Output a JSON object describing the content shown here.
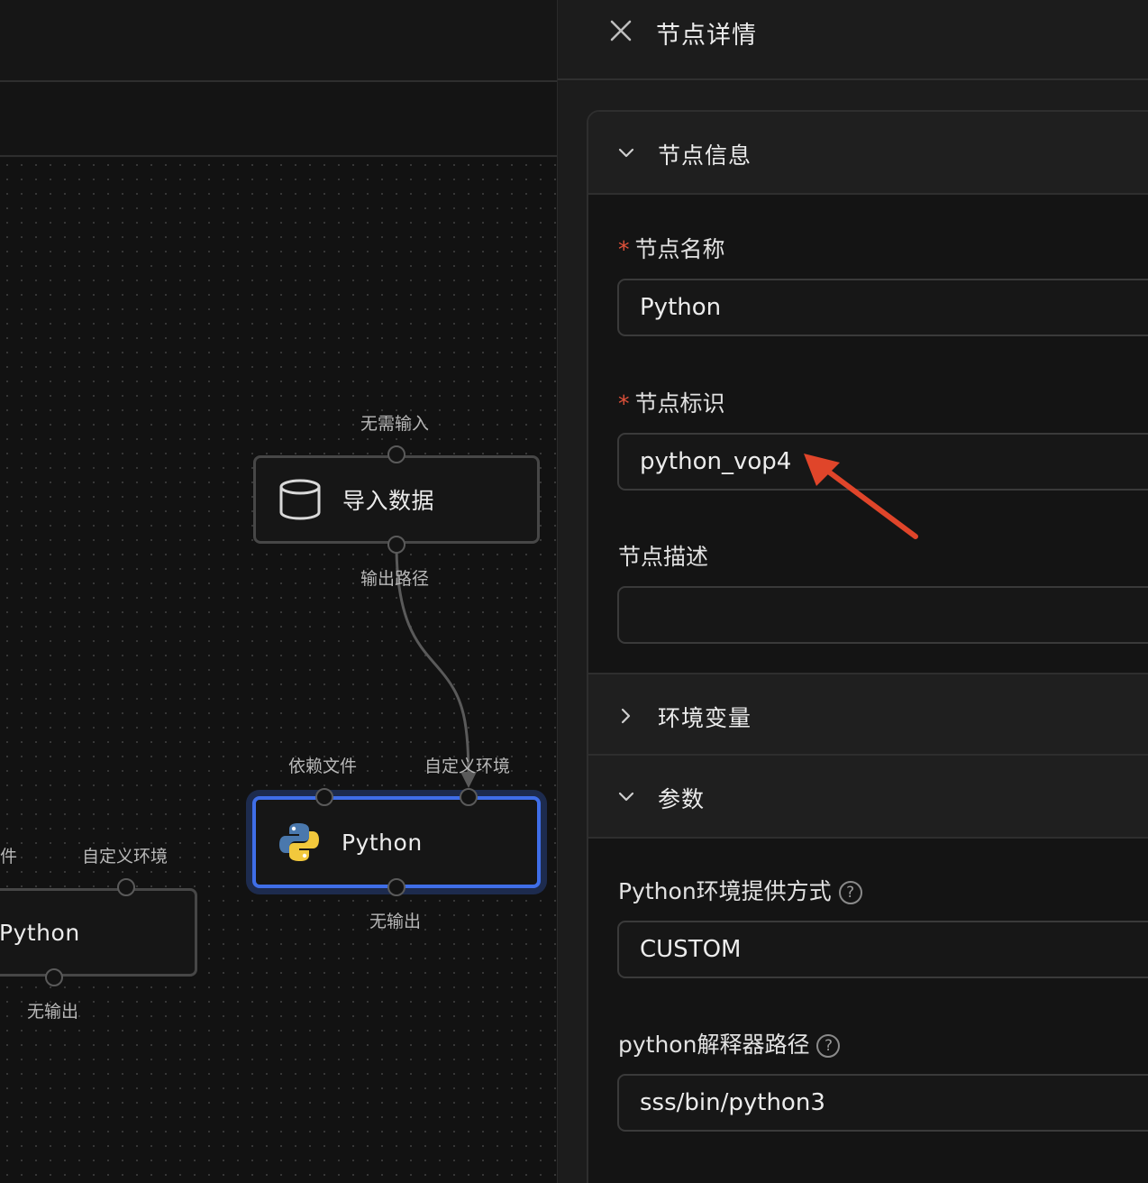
{
  "canvas": {
    "nodes": [
      {
        "label": "导入数据",
        "icon": "database-icon",
        "input_label": "无需输入",
        "output_label": "输出路径"
      },
      {
        "label": "Python",
        "icon": "python-logo-icon",
        "input_labels": [
          "依赖文件",
          "自定义环境"
        ],
        "output_label": "无输出",
        "selected": true
      },
      {
        "label": "Python",
        "icon": "python-logo-icon",
        "input_labels": [
          "件",
          "自定义环境"
        ],
        "output_label": "无输出"
      }
    ]
  },
  "panel": {
    "title": "节点详情",
    "sections": {
      "node_info": {
        "title": "节点信息",
        "expanded": true,
        "fields": {
          "name": {
            "label": "节点名称",
            "required": true,
            "value": "Python"
          },
          "id": {
            "label": "节点标识",
            "required": true,
            "value": "python_vop4"
          },
          "description": {
            "label": "节点描述",
            "required": false,
            "value": ""
          }
        }
      },
      "env_vars": {
        "title": "环境变量",
        "expanded": false
      },
      "params": {
        "title": "参数",
        "expanded": true,
        "fields": {
          "env_provider": {
            "label": "Python环境提供方式",
            "value": "CUSTOM",
            "help": "?"
          },
          "interpreter_path": {
            "label": "python解释器路径",
            "value": "sss/bin/python3",
            "help": "?"
          }
        }
      }
    }
  },
  "colors": {
    "accent": "#3f6ee8",
    "annotation_arrow": "#e0452a",
    "required_star": "#e0513a"
  }
}
